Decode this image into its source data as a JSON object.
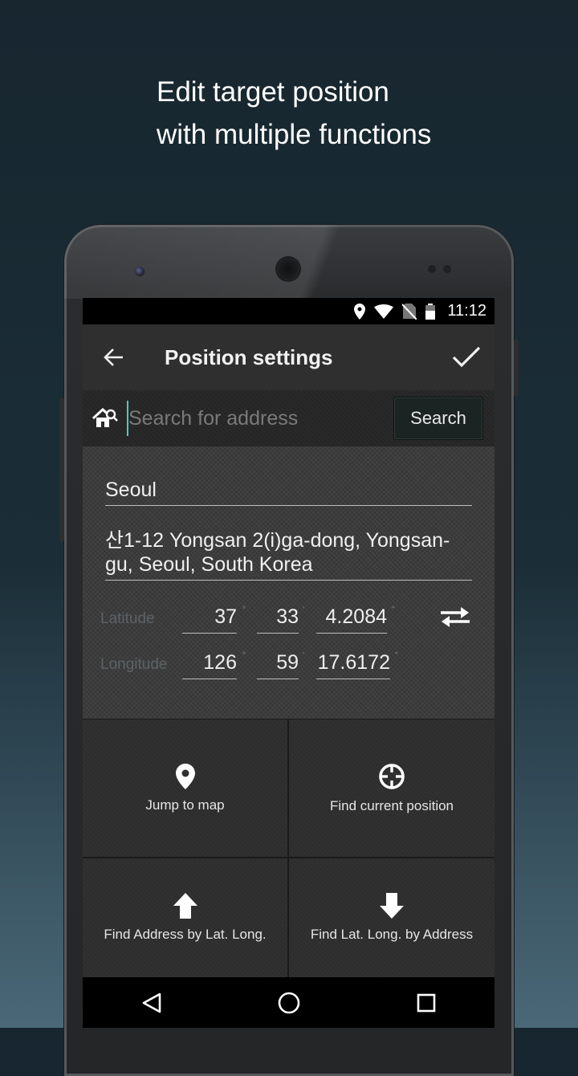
{
  "promo": {
    "line1": "Edit target position",
    "line2": "with multiple functions"
  },
  "status_bar": {
    "time": "11:12",
    "icons": [
      "location-icon",
      "wifi-icon",
      "no-sim-icon",
      "battery-icon"
    ]
  },
  "app_bar": {
    "title": "Position settings",
    "back_icon": "arrow-left-icon",
    "confirm_icon": "check-icon"
  },
  "search": {
    "placeholder": "Search for address",
    "value": "",
    "button_label": "Search"
  },
  "location": {
    "city": "Seoul",
    "address": "산1-12 Yongsan 2(i)ga-dong, Yongsan-gu, Seoul, South Korea"
  },
  "coordinates": {
    "latitude": {
      "label": "Latitude",
      "degrees": "37",
      "minutes": "33",
      "seconds": "4.2084"
    },
    "longitude": {
      "label": "Longitude",
      "degrees": "126",
      "minutes": "59",
      "seconds": "17.6172"
    },
    "units": {
      "degree": "°",
      "minute": "'",
      "second": "\""
    }
  },
  "actions": {
    "jump_to_map": "Jump to map",
    "find_current_position": "Find current position",
    "find_address_by_latlong": "Find Address by Lat. Long.",
    "find_latlong_by_address": "Find Lat. Long. by Address"
  },
  "colors": {
    "accent": "#58c5c0",
    "background_top": "#17262f",
    "background_bottom": "#4a6878",
    "label_muted": "#5c6266"
  }
}
